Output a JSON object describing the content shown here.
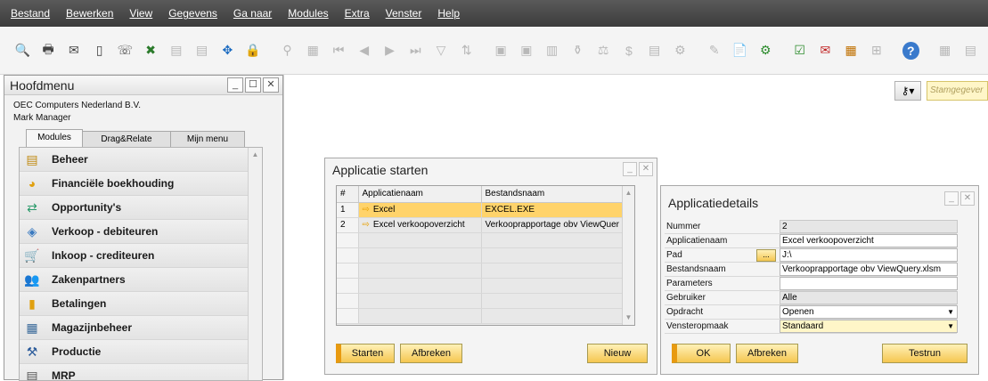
{
  "menubar": [
    "Bestand",
    "Bewerken",
    "View",
    "Gegevens",
    "Ga naar",
    "Modules",
    "Extra",
    "Venster",
    "Help"
  ],
  "finder": {
    "placeholder": "Stamgegever"
  },
  "main_menu": {
    "title": "Hoofdmenu",
    "company": "OEC Computers Nederland B.V.",
    "user": "Mark Manager",
    "tabs": [
      "Modules",
      "Drag&Relate",
      "Mijn menu"
    ],
    "modules": [
      {
        "label": "Beheer",
        "icon": "admin-icon"
      },
      {
        "label": "Financiële boekhouding",
        "icon": "finance-icon"
      },
      {
        "label": "Opportunity's",
        "icon": "opportunity-icon"
      },
      {
        "label": "Verkoop - debiteuren",
        "icon": "sales-icon"
      },
      {
        "label": "Inkoop - crediteuren",
        "icon": "purchase-icon"
      },
      {
        "label": "Zakenpartners",
        "icon": "partners-icon"
      },
      {
        "label": "Betalingen",
        "icon": "payments-icon"
      },
      {
        "label": "Magazijnbeheer",
        "icon": "inventory-icon"
      },
      {
        "label": "Productie",
        "icon": "production-icon"
      },
      {
        "label": "MRP",
        "icon": "mrp-icon"
      }
    ]
  },
  "app_start": {
    "title": "Applicatie starten",
    "columns": [
      "#",
      "Applicatienaam",
      "Bestandsnaam"
    ],
    "rows": [
      {
        "num": "1",
        "name": "Excel",
        "file": "EXCEL.EXE"
      },
      {
        "num": "2",
        "name": "Excel verkoopoverzicht",
        "file": "Verkooprapportage obv ViewQuer"
      }
    ],
    "buttons": {
      "start": "Starten",
      "cancel": "Afbreken",
      "new": "Nieuw"
    }
  },
  "app_details": {
    "title": "Applicatiedetails",
    "fields": {
      "nummer": {
        "label": "Nummer",
        "value": "2"
      },
      "naam": {
        "label": "Applicatienaam",
        "value": "Excel verkoopoverzicht"
      },
      "pad": {
        "label": "Pad",
        "value": "J:\\",
        "browse": "..."
      },
      "bestand": {
        "label": "Bestandsnaam",
        "value": "Verkooprapportage obv ViewQuery.xlsm"
      },
      "parameters": {
        "label": "Parameters",
        "value": ""
      },
      "gebruiker": {
        "label": "Gebruiker",
        "value": "Alle"
      },
      "opdracht": {
        "label": "Opdracht",
        "value": "Openen"
      },
      "venster": {
        "label": "Vensteropmaak",
        "value": "Standaard"
      }
    },
    "buttons": {
      "ok": "OK",
      "cancel": "Afbreken",
      "test": "Testrun"
    }
  }
}
